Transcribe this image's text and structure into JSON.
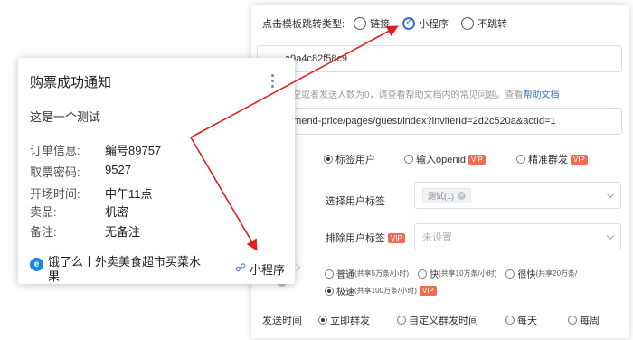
{
  "panel": {
    "jump_label": "点击模板跳转类型:",
    "jump_options": [
      "链接",
      "小程序",
      "不跳转"
    ],
    "appid_value": "a9a4c82f58c9",
    "help_text": "为空或者发送人数为0，请查看帮助文档内的常见问题。查看",
    "help_link": "帮助文档",
    "path_value": "mmend-price/pages/guest/index?inviterId=2d2c520a&actId=1",
    "target_options": [
      "标签用户",
      "输入openid",
      "精准群发"
    ],
    "vip_badge": "VIP",
    "select_tag_label": "选择用户标签",
    "selected_tag": "测试(1)",
    "exclude_tag_label": "排除用户标签",
    "exclude_placeholder": "未设置",
    "speed_options": [
      "普通",
      "快",
      "很快",
      "极速"
    ],
    "speed_notes": [
      "(共享5万条/小时)",
      "(共享10万条/小时)",
      "(共享20万条/",
      "(共享100万条/小时)"
    ],
    "send_time_label": "发送时间",
    "send_time_options": [
      "立即群发",
      "自定义群发时间",
      "每天",
      "每周"
    ]
  },
  "card": {
    "title": "购票成功通知",
    "description": "这是一个测试",
    "fields": [
      {
        "key": "订单信息:",
        "value": "编号89757"
      },
      {
        "key": "取票密码:",
        "value": "9527"
      },
      {
        "key": "开场时间:",
        "value": "中午11点"
      },
      {
        "key": "卖品:",
        "value": "机密"
      },
      {
        "key": "备注:",
        "value": "无备注"
      }
    ],
    "mp_name": "饿了么丨外卖美食超市买菜水果",
    "mp_label": "小程序",
    "mp_logo_glyph": "e"
  },
  "colors": {
    "accent": "#3a6fd8",
    "arrow": "#e0201c",
    "vip": "#f26b4f"
  }
}
